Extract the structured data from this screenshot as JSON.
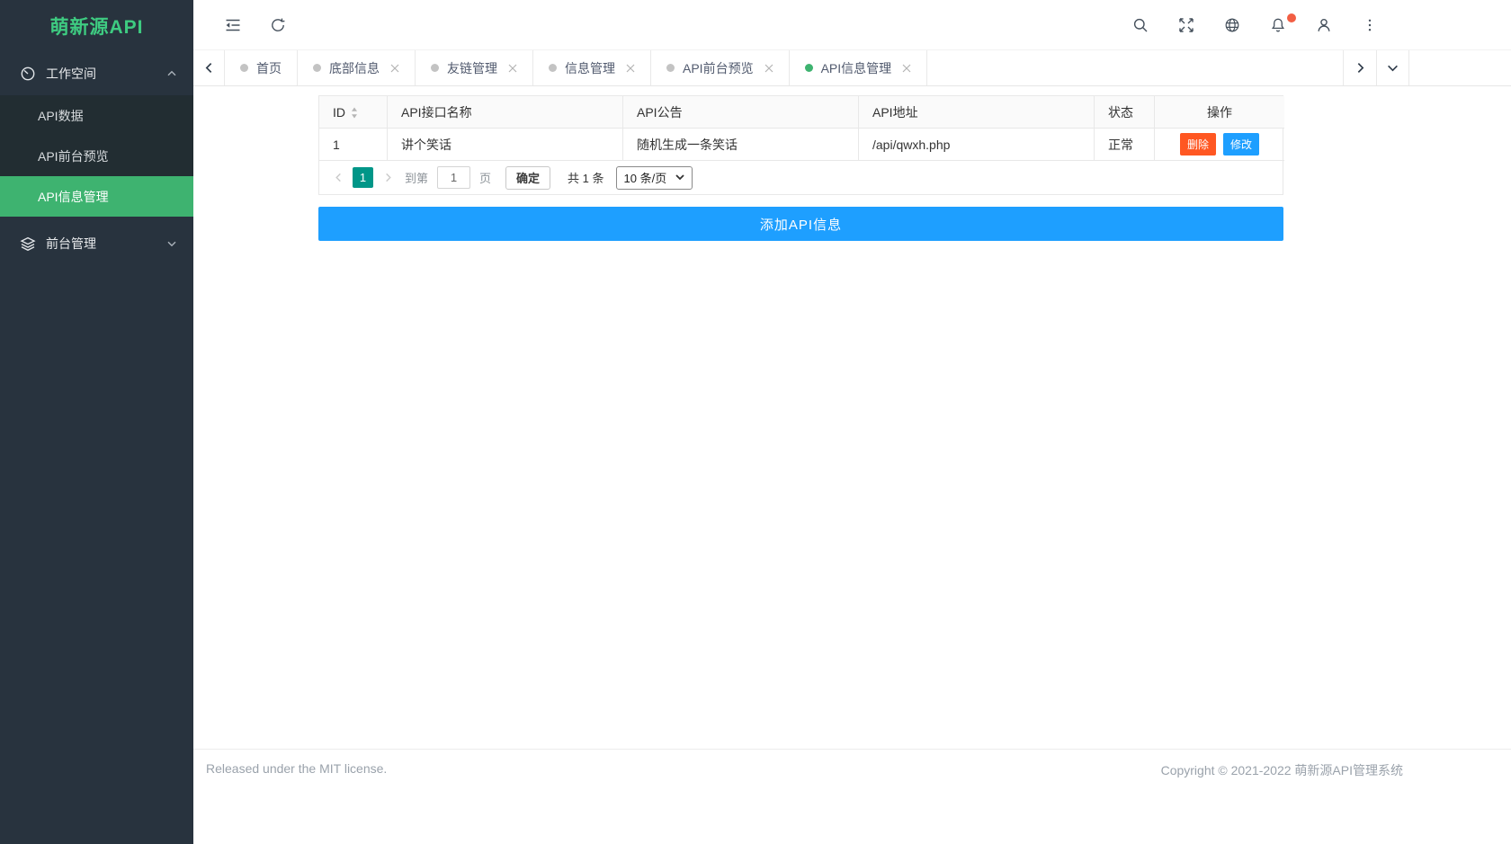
{
  "colors": {
    "sidebar_bg": "#28333e",
    "submenu_bg": "#222d32",
    "accent_green": "#3eb370",
    "logo_green": "#3ecb81",
    "accent_blue": "#1e9fff",
    "danger_red": "#ff5722",
    "pager_teal": "#009688",
    "notice_dot": "#f25e43"
  },
  "sidebar": {
    "logo": "萌新源API",
    "workspace": {
      "label": "工作空间",
      "icon": "dashboard-icon",
      "items": [
        {
          "label": "API数据"
        },
        {
          "label": "API前台预览"
        },
        {
          "label": "API信息管理"
        }
      ]
    },
    "frontend": {
      "label": "前台管理",
      "icon": "layers-icon"
    }
  },
  "header": {
    "icons": [
      "collapse-sidebar-icon",
      "refresh-icon",
      "search-icon",
      "fullscreen-icon",
      "globe-icon",
      "bell-icon",
      "user-icon",
      "more-icon"
    ]
  },
  "tabs": [
    {
      "label": "首页",
      "closable": false,
      "active": false
    },
    {
      "label": "底部信息",
      "closable": true,
      "active": false
    },
    {
      "label": "友链管理",
      "closable": true,
      "active": false
    },
    {
      "label": "信息管理",
      "closable": true,
      "active": false
    },
    {
      "label": "API前台预览",
      "closable": true,
      "active": false
    },
    {
      "label": "API信息管理",
      "closable": true,
      "active": true
    }
  ],
  "table": {
    "columns": {
      "id": "ID",
      "name": "API接口名称",
      "notice": "API公告",
      "url": "API地址",
      "status": "状态",
      "actions": "操作"
    },
    "rows": [
      {
        "id": "1",
        "name": "讲个笑话",
        "notice": "随机生成一条笑话",
        "url": "/api/qwxh.php",
        "status": "正常",
        "delete": "删除",
        "edit": "修改"
      }
    ]
  },
  "pagination": {
    "current_page": "1",
    "goto_label": "到第",
    "goto_value": "1",
    "page_label": "页",
    "confirm_label": "确定",
    "total_label": "共 1 条",
    "page_size_label": "10 条/页"
  },
  "add_button_label": "添加API信息",
  "footer": {
    "left": "Released under the MIT license.",
    "right": "Copyright © 2021-2022 萌新源API管理系统"
  }
}
